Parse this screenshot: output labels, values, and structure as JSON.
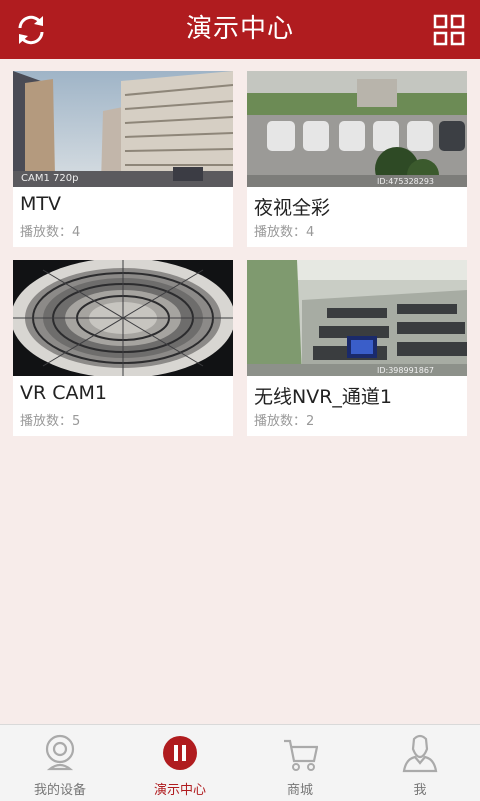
{
  "header": {
    "title": "演示中心",
    "left_icon": "refresh-icon",
    "right_icon": "grid-view-icon"
  },
  "cameras": [
    {
      "name": "MTV",
      "plays_label": "播放数：4",
      "overlay": "CAM1 720p"
    },
    {
      "name": "夜视全彩",
      "plays_label": "播放数：4",
      "overlay": "ID:475328293"
    },
    {
      "name": "VR CAM1",
      "plays_label": "播放数：5",
      "overlay": ""
    },
    {
      "name": "无线NVR_通道1",
      "plays_label": "播放数：2",
      "overlay": "ID:398991867"
    }
  ],
  "tabs": [
    {
      "label": "我的设备",
      "icon": "camera-device-icon",
      "active": false
    },
    {
      "label": "演示中心",
      "icon": "pause-circle-icon",
      "active": true
    },
    {
      "label": "商城",
      "icon": "shopping-cart-icon",
      "active": false
    },
    {
      "label": "我",
      "icon": "user-icon",
      "active": false
    }
  ],
  "colors": {
    "brand": "#b01c1f",
    "background": "#f7ecea",
    "tab_inactive": "#777777"
  }
}
